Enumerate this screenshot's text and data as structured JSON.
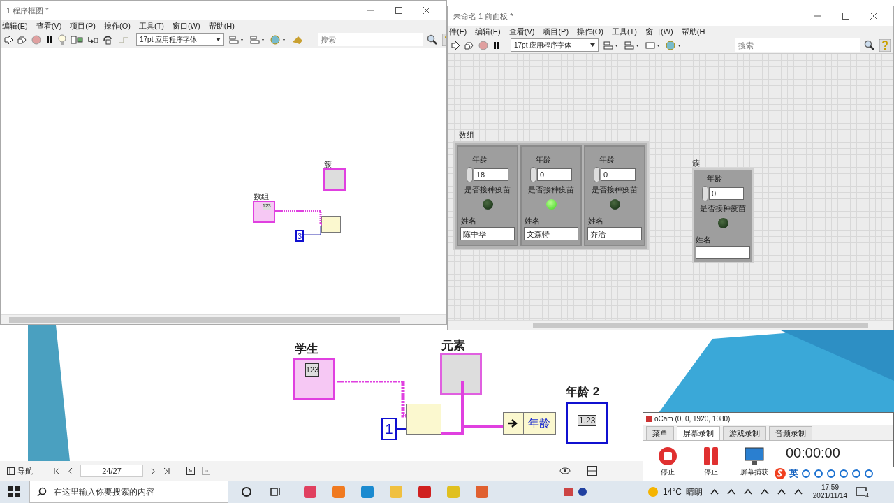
{
  "block_diagram_window": {
    "title": "1 程序框图 *",
    "menu": [
      "编辑(E)",
      "查看(V)",
      "项目(P)",
      "操作(O)",
      "工具(T)",
      "窗口(W)",
      "帮助(H)"
    ],
    "font_select": "17pt 应用程序字体",
    "search": {
      "placeholder": "搜索"
    },
    "nodes": [
      {
        "kind": "cluster",
        "label": "簇"
      },
      {
        "kind": "array",
        "label": "数组",
        "glyph": "123"
      },
      {
        "kind": "index"
      },
      {
        "kind": "constant",
        "value": "3"
      }
    ]
  },
  "front_panel_window": {
    "title": "未命名 1 前面板 *",
    "menu": [
      "件(F)",
      "编辑(E)",
      "查看(V)",
      "项目(P)",
      "操作(O)",
      "工具(T)",
      "窗口(W)",
      "帮助(H"
    ],
    "font_select": "17pt 应用程序字体",
    "search": {
      "placeholder": "搜索"
    },
    "array": {
      "label": "数组",
      "elements": [
        {
          "age_label": "年龄",
          "age": "18",
          "led_label": "是否接种疫苗",
          "on": false,
          "name_label": "姓名",
          "name": "陈中华"
        },
        {
          "age_label": "年龄",
          "age": "0",
          "led_label": "是否接种疫苗",
          "on": true,
          "name_label": "姓名",
          "name": "文森特"
        },
        {
          "age_label": "年龄",
          "age": "0",
          "led_label": "是否接种疫苗",
          "on": false,
          "name_label": "姓名",
          "name": "乔治"
        }
      ]
    },
    "cluster": {
      "label": "簇",
      "age_label": "年龄",
      "age": "0",
      "led_label": "是否接种疫苗",
      "on": false,
      "name_label": "姓名"
    }
  },
  "slide": {
    "array_label": "学生",
    "array_glyph": "123",
    "cluster_label": "元素",
    "constant": "1",
    "unbundle_field": "年龄",
    "indicator_label": "年龄 2",
    "indicator_glyph": "1.23"
  },
  "slide_viewer": {
    "nav_label": "导航",
    "page": "24/27"
  },
  "ocam": {
    "title": "oCam (0, 0, 1920, 1080)",
    "tabs": [
      {
        "label": "菜单",
        "selected": false
      },
      {
        "label": "屏幕录制",
        "selected": true
      },
      {
        "label": "游戏录制",
        "selected": false
      },
      {
        "label": "音频录制",
        "selected": false
      }
    ],
    "buttons": [
      {
        "kind": "stop",
        "label": "停止"
      },
      {
        "kind": "pause",
        "label": "停止"
      },
      {
        "kind": "capture",
        "label": "屏幕捕获"
      }
    ],
    "timer": "00:00:00"
  },
  "ime_bar": {
    "mode": "英"
  },
  "taskbar": {
    "search_placeholder": "在这里输入你要搜索的内容",
    "temperature": "14°C",
    "weather": "晴朗",
    "time": "17:59",
    "date": "2021/11/14",
    "notification_count": "4"
  }
}
